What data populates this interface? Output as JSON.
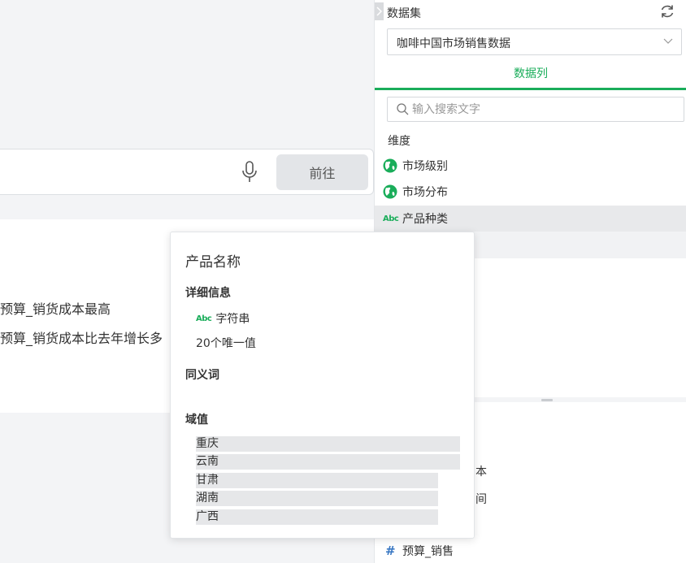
{
  "query": {
    "go_label": "前往"
  },
  "suggestions": [
    "预算_销货成本最高",
    "预算_销货成本比去年增长多"
  ],
  "panel": {
    "title": "数据集",
    "dataset_value": "咖啡中国市场销售数据",
    "tab_label": "数据列",
    "search_placeholder": "输入搜索文字",
    "dimension_label": "维度",
    "fields": [
      {
        "label": "市场级别",
        "icon": "globe-icon"
      },
      {
        "label": "市场分布",
        "icon": "globe-icon"
      },
      {
        "label": "产品种类",
        "icon": "abc-icon"
      }
    ],
    "lower_partial": [
      "本",
      "间"
    ],
    "measure_field": "预算_销售",
    "abc_text": "Abc"
  },
  "popover": {
    "title": "产品名称",
    "details_heading": "详细信息",
    "type_label": "字符串",
    "unique_count": "20个唯一值",
    "synonyms_heading": "同义词",
    "domain_heading": "域值",
    "domain_values": [
      "重庆",
      "云南",
      "甘肃",
      "湖南",
      "广西"
    ]
  },
  "colors": {
    "accent": "#1aad5a",
    "measure": "#3a78c3"
  }
}
